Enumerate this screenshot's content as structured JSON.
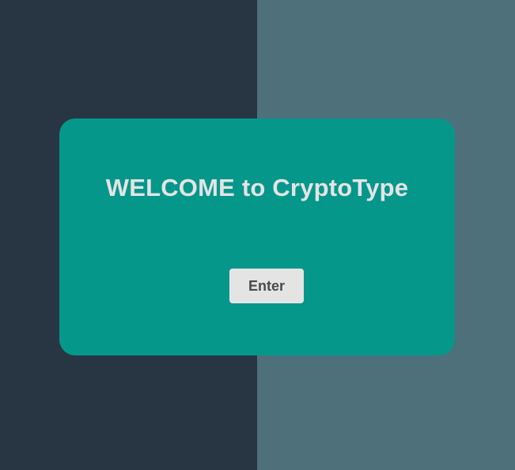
{
  "welcome": {
    "title": "WELCOME to CryptoType",
    "enter_label": "Enter"
  },
  "colors": {
    "left_bg": "#283543",
    "right_bg": "#4e707b",
    "card_bg": "#06978b",
    "button_bg": "#e4e4e4"
  }
}
